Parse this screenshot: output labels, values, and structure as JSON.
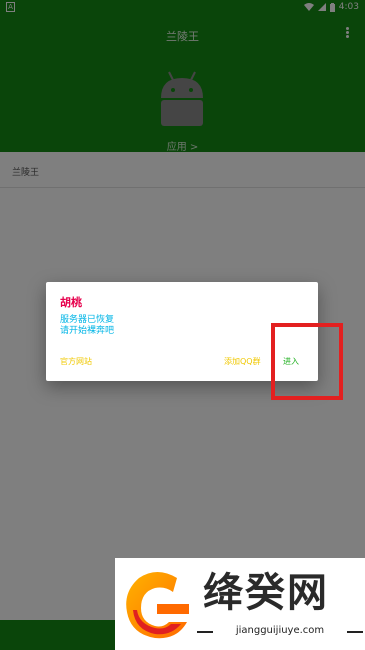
{
  "status_bar": {
    "left_icon": "A",
    "time": "4:03",
    "icons": [
      "wifi-icon",
      "signal-icon",
      "battery-icon"
    ]
  },
  "app": {
    "title": "兰陵王",
    "apps_link": "应用 >",
    "section_label": "兰陵王"
  },
  "dialog": {
    "title": "胡桃",
    "message_lines": [
      "服务器已恢复",
      "请开始裸奔吧"
    ],
    "buttons": {
      "official": "官方网站",
      "qq_group": "添加QQ群",
      "enter": "进入"
    }
  },
  "watermark": {
    "brand": "绛癸网",
    "url": "jiangguijiuye.com"
  },
  "colors": {
    "app_green": "#158a15",
    "dialog_title": "#e6004c",
    "dialog_message": "#00b5e6",
    "button_yellow": "#f0c800",
    "button_green": "#21b021",
    "highlight_red": "#e32020"
  }
}
